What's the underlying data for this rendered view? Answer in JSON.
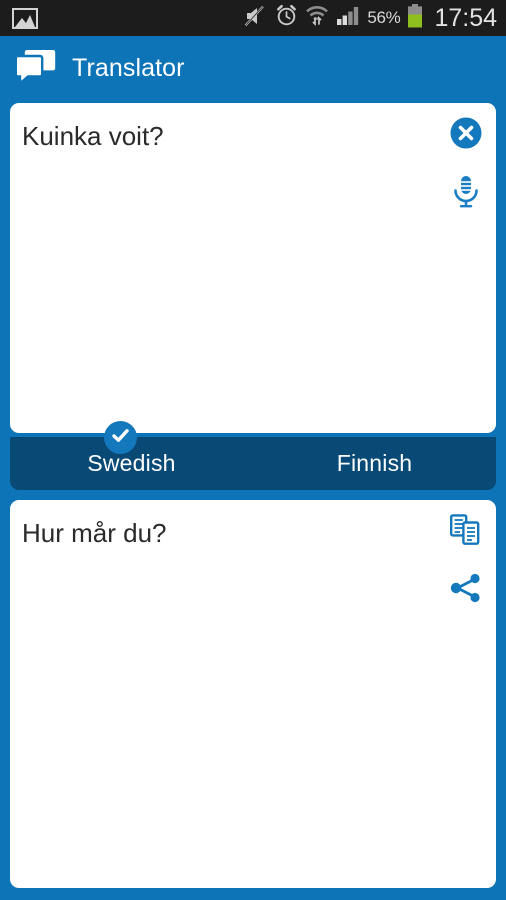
{
  "status_bar": {
    "notification_icon": "photo-icon",
    "icons": [
      "mute-icon",
      "alarm-clock-icon",
      "wifi-icon",
      "signal-bars-icon"
    ],
    "battery_percent": "56%",
    "battery_icon": "battery-icon",
    "time": "17:54",
    "background": "#1c1c1c"
  },
  "app_bar": {
    "icon": "chat-bubbles-icon",
    "title": "Translator",
    "background": "#0d74b8"
  },
  "source_card": {
    "text": "Kuinka voit?",
    "clear_button": {
      "name": "clear-icon",
      "label": "✕"
    },
    "mic_button": {
      "name": "microphone-icon"
    }
  },
  "language_bar": {
    "background": "#084a75",
    "selected_indicator": "check-icon",
    "options": [
      {
        "label": "Swedish",
        "selected": true
      },
      {
        "label": "Finnish",
        "selected": false
      }
    ]
  },
  "target_card": {
    "text": "Hur mår du?",
    "copy_button": {
      "name": "copy-icon"
    },
    "share_button": {
      "name": "share-icon"
    }
  },
  "theme": {
    "primary_blue": "#0d74b8",
    "dark_blue": "#084a75",
    "accent_blue": "#1478bd",
    "card_white": "#ffffff",
    "text_dark": "#2a2a2a"
  }
}
